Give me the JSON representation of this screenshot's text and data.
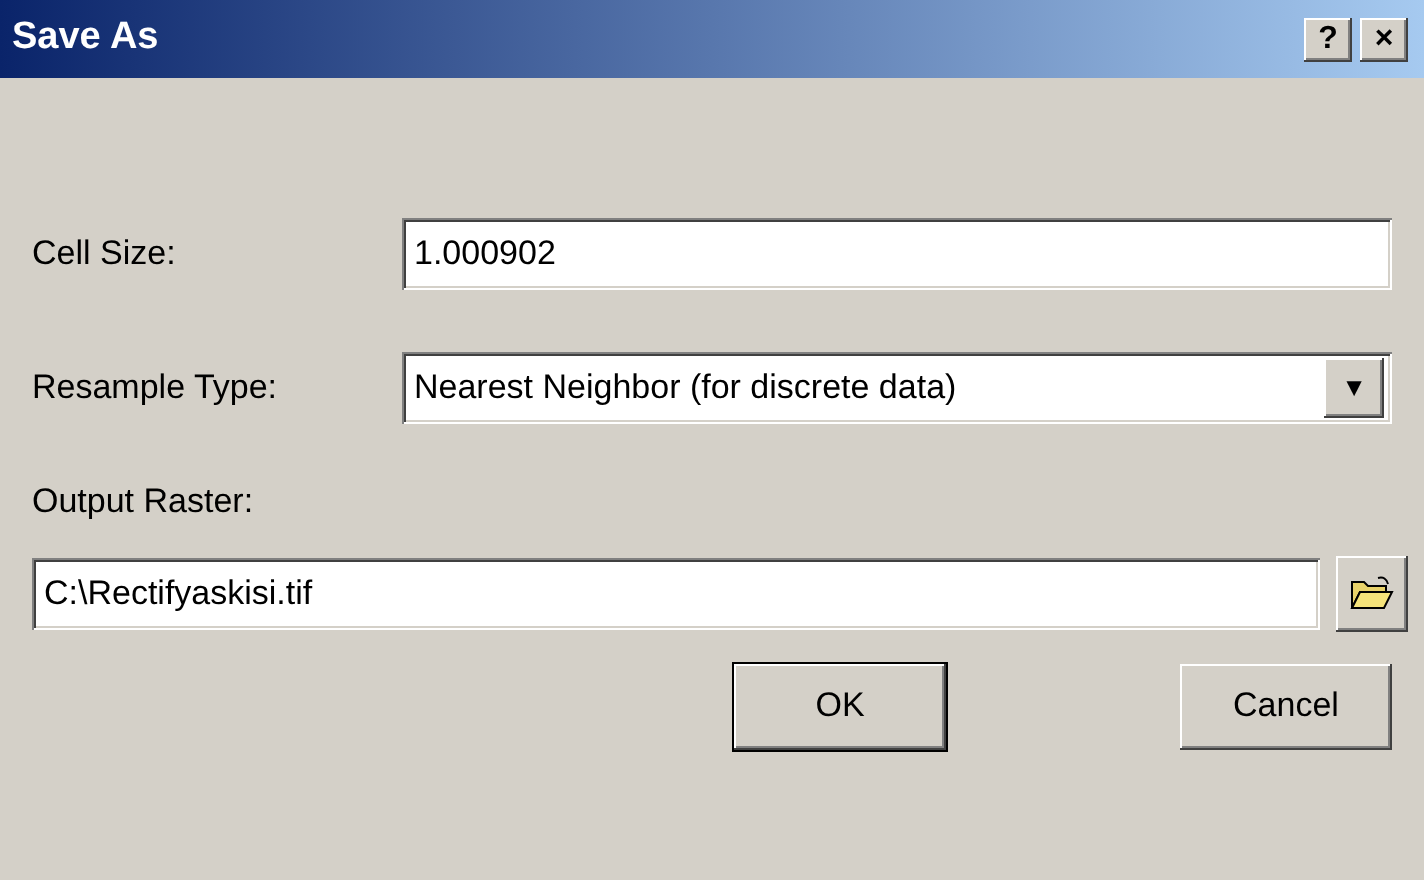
{
  "window": {
    "title": "Save As",
    "title_buttons": [
      "?",
      "×"
    ]
  },
  "fields": [
    {
      "kind": "text",
      "label": "Cell Size:",
      "value": "1.000902"
    },
    {
      "kind": "dropdown",
      "label": "Resample Type:",
      "value": "Nearest Neighbor (for discrete data)",
      "arrow": "▼"
    }
  ],
  "output": {
    "label": "Output Raster:",
    "value": "C:\\Rectifyaskisi.tif"
  },
  "buttons": [
    "OK",
    "Cancel"
  ]
}
